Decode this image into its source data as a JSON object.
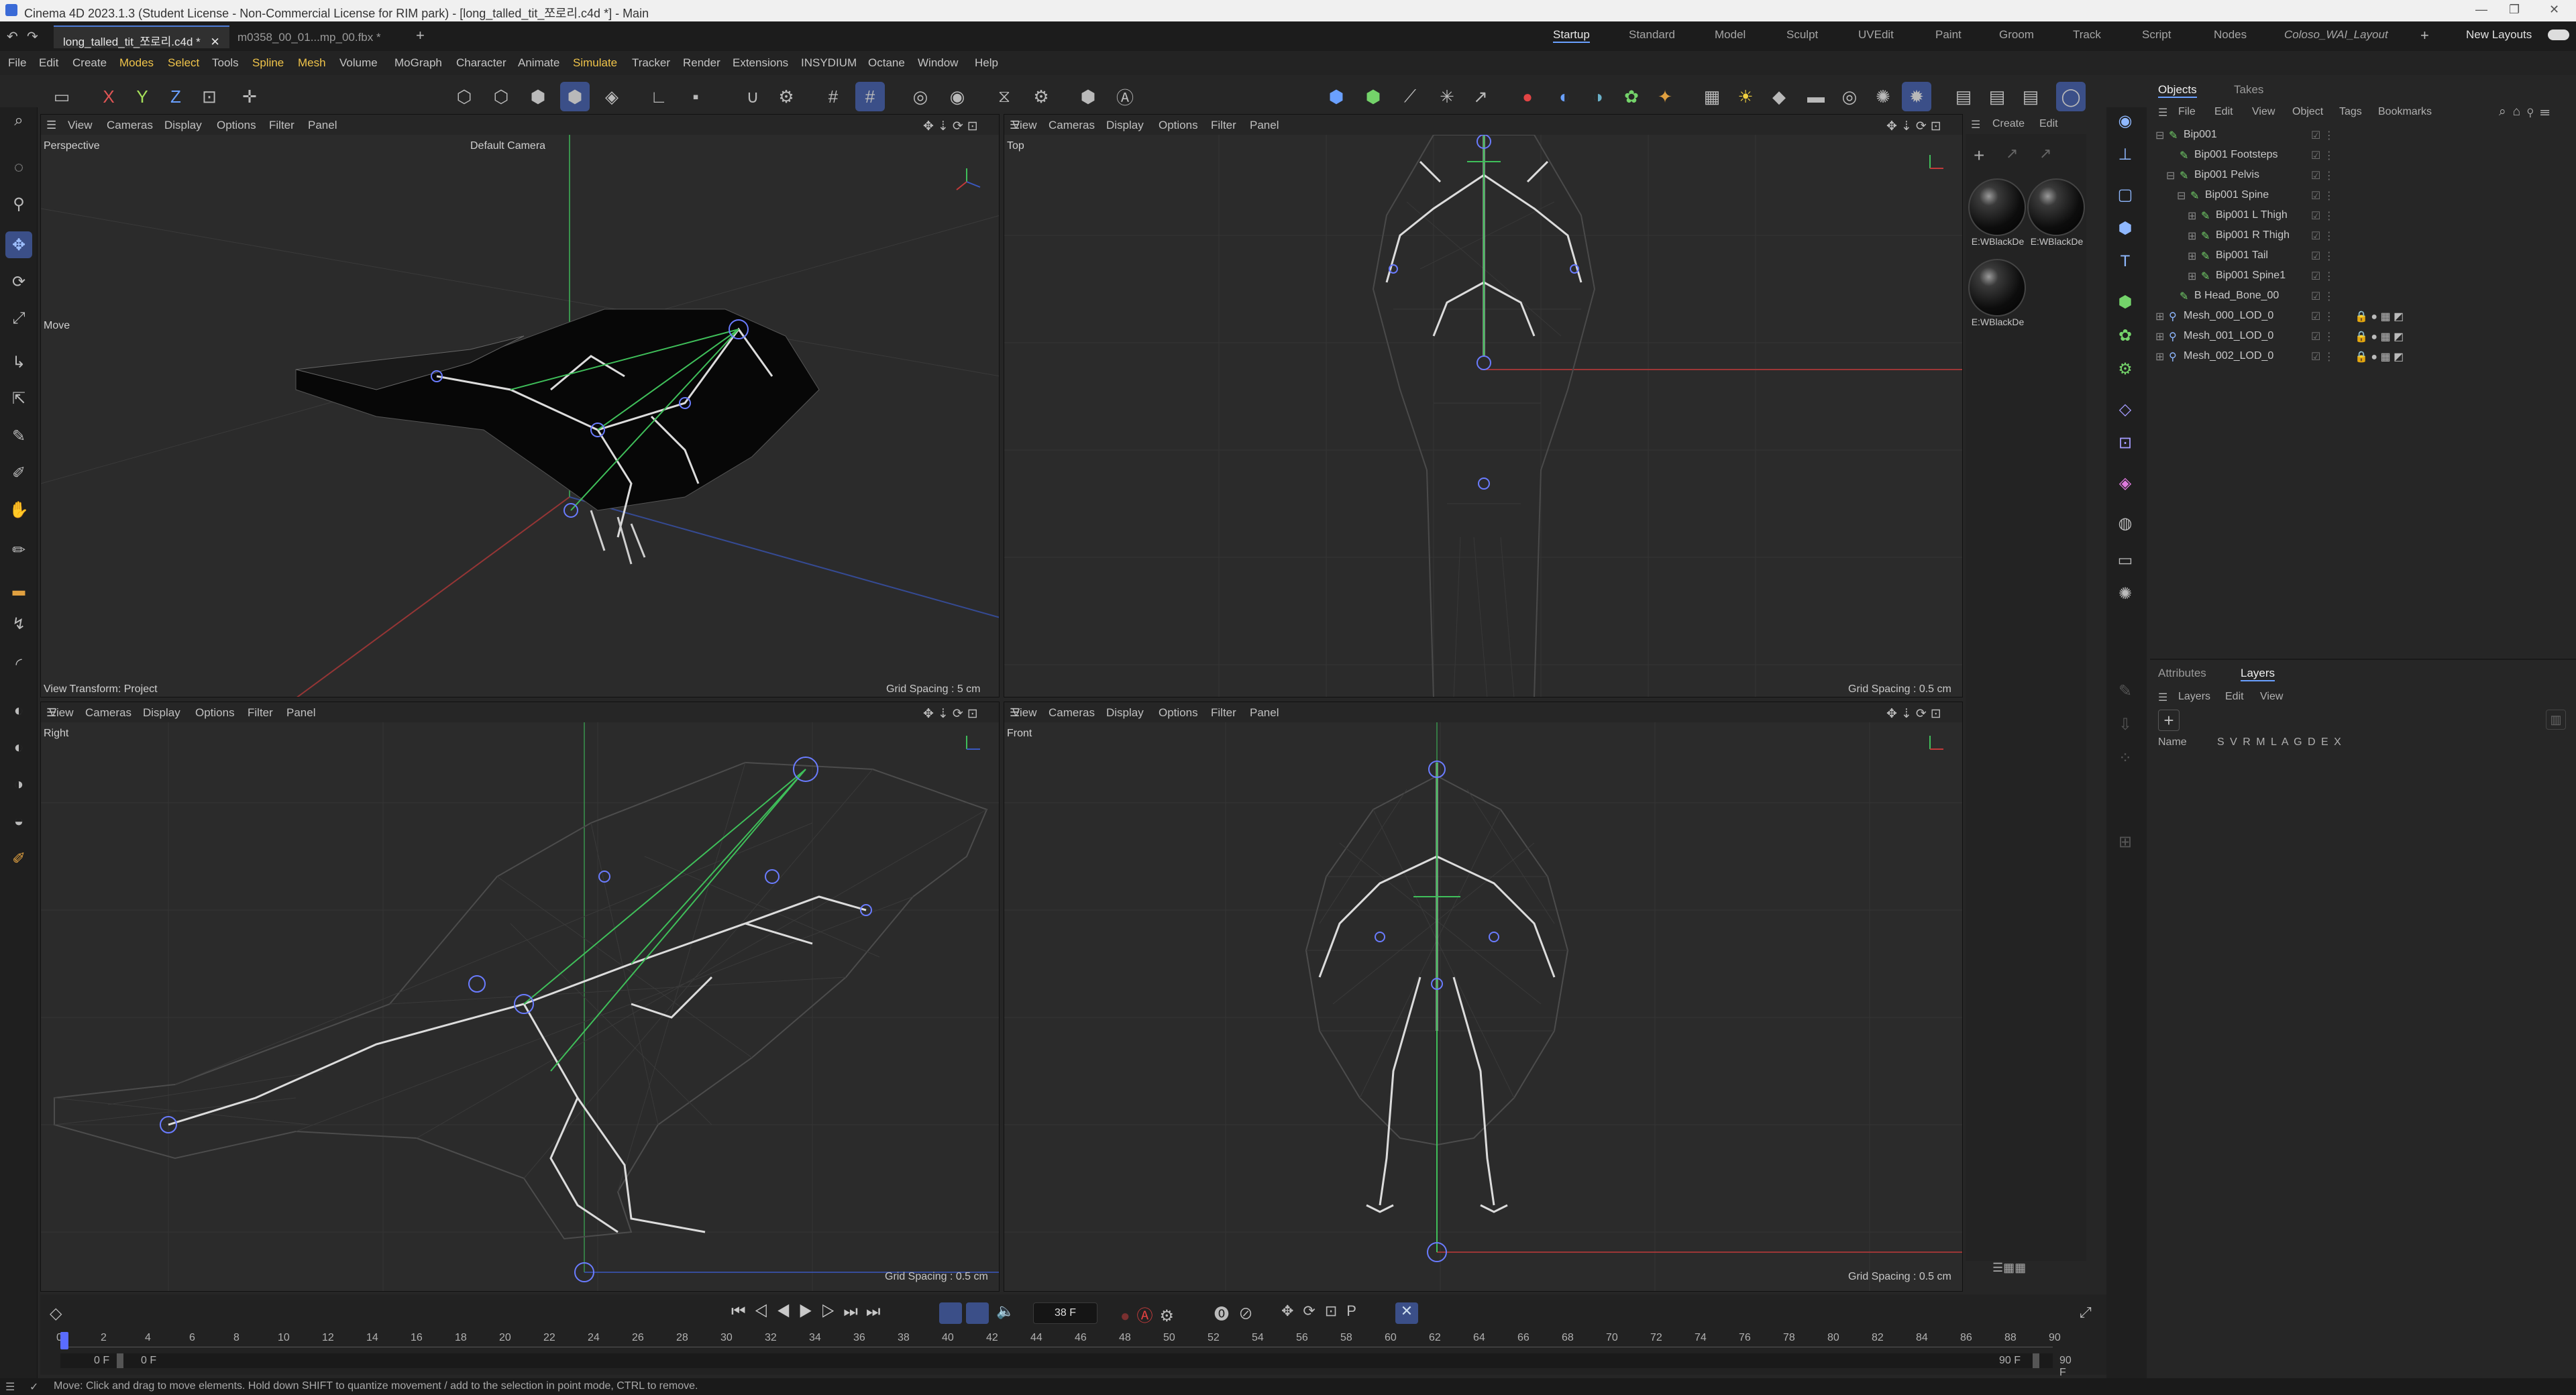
{
  "window": {
    "title": "Cinema 4D 2023.1.3 (Student License - Non-Commercial License for RIM park) - [long_talled_tit_쪼로리.c4d *] - Main"
  },
  "doc_tabs": [
    {
      "label": "long_talled_tit_쪼로리.c4d *",
      "active": true
    },
    {
      "label": "m0358_00_01...mp_00.fbx *",
      "active": false
    }
  ],
  "layouts": [
    "Startup",
    "Standard",
    "Model",
    "Sculpt",
    "UVEdit",
    "Paint",
    "Groom",
    "Track",
    "Script",
    "Nodes",
    "Coloso_WAI_Layout"
  ],
  "active_layout": "Startup",
  "new_layouts_label": "New Layouts",
  "menu": [
    "File",
    "Edit",
    "Create",
    "Modes",
    "Select",
    "Tools",
    "Spline",
    "Mesh",
    "Volume",
    "MoGraph",
    "Character",
    "Animate",
    "Simulate",
    "Tracker",
    "Render",
    "Extensions",
    "INSYDIUM",
    "Octane",
    "Window",
    "Help"
  ],
  "viewport_menu": [
    "View",
    "Cameras",
    "Display",
    "Options",
    "Filter",
    "Panel"
  ],
  "viewports": {
    "perspective": {
      "name": "Perspective",
      "camera": "Default Camera",
      "grid": "Grid Spacing : 5 cm",
      "view_transform": "View Transform: Project",
      "tool_label": "Move"
    },
    "top": {
      "name": "Top",
      "grid": "Grid Spacing : 0.5 cm"
    },
    "right": {
      "name": "Right",
      "grid": "Grid Spacing : 0.5 cm"
    },
    "front": {
      "name": "Front",
      "grid": "Grid Spacing : 0.5 cm"
    }
  },
  "material_panel": {
    "menu": [
      "Create",
      "Edit"
    ],
    "materials": [
      "E:WBlackDe",
      "E:WBlackDe",
      "E:WBlackDe"
    ]
  },
  "objects_panel": {
    "tabs": [
      "Objects",
      "Takes"
    ],
    "menu": [
      "File",
      "Edit",
      "View",
      "Object",
      "Tags",
      "Bookmarks"
    ],
    "items": [
      {
        "name": "Bip001",
        "depth": 0
      },
      {
        "name": "Bip001 Footsteps",
        "depth": 1
      },
      {
        "name": "Bip001 Pelvis",
        "depth": 1
      },
      {
        "name": "Bip001 Spine",
        "depth": 2
      },
      {
        "name": "Bip001 L Thigh",
        "depth": 3
      },
      {
        "name": "Bip001 R Thigh",
        "depth": 3
      },
      {
        "name": "Bip001 Tail",
        "depth": 3
      },
      {
        "name": "Bip001 Spine1",
        "depth": 3
      },
      {
        "name": "B Head_Bone_00",
        "depth": 2
      },
      {
        "name": "Mesh_000_LOD_0",
        "depth": 0
      },
      {
        "name": "Mesh_001_LOD_0",
        "depth": 0
      },
      {
        "name": "Mesh_002_LOD_0",
        "depth": 0
      }
    ]
  },
  "layers_panel": {
    "tabs": [
      "Attributes",
      "Layers"
    ],
    "menu": [
      "Layers",
      "Edit",
      "View"
    ],
    "name_col": "Name",
    "flags": "S V R M L A G D E X"
  },
  "timeline": {
    "ticks": [
      "0",
      "2",
      "4",
      "6",
      "8",
      "10",
      "12",
      "14",
      "16",
      "18",
      "20",
      "22",
      "24",
      "26",
      "28",
      "30",
      "32",
      "34",
      "36",
      "38",
      "40",
      "42",
      "44",
      "46",
      "48",
      "50",
      "52",
      "54",
      "56",
      "58",
      "60",
      "62",
      "64",
      "66",
      "68",
      "70",
      "72",
      "74",
      "76",
      "78",
      "80",
      "82",
      "84",
      "86",
      "88",
      "90"
    ],
    "current_frame": "38 F",
    "start": "0 F",
    "start2": "0 F",
    "end": "90 F",
    "end2": "90 F",
    "playhead_fraction": 0.0
  },
  "status": "Move: Click and drag to move elements. Hold down SHIFT to quantize movement / add to the selection in point mode, CTRL to remove.",
  "colors": {
    "accent": "#3b4f88",
    "bone": "#e8e8e8",
    "joint": "#5a6cff",
    "green_axis": "#3fbf5a",
    "red_axis": "#c23a3a"
  }
}
